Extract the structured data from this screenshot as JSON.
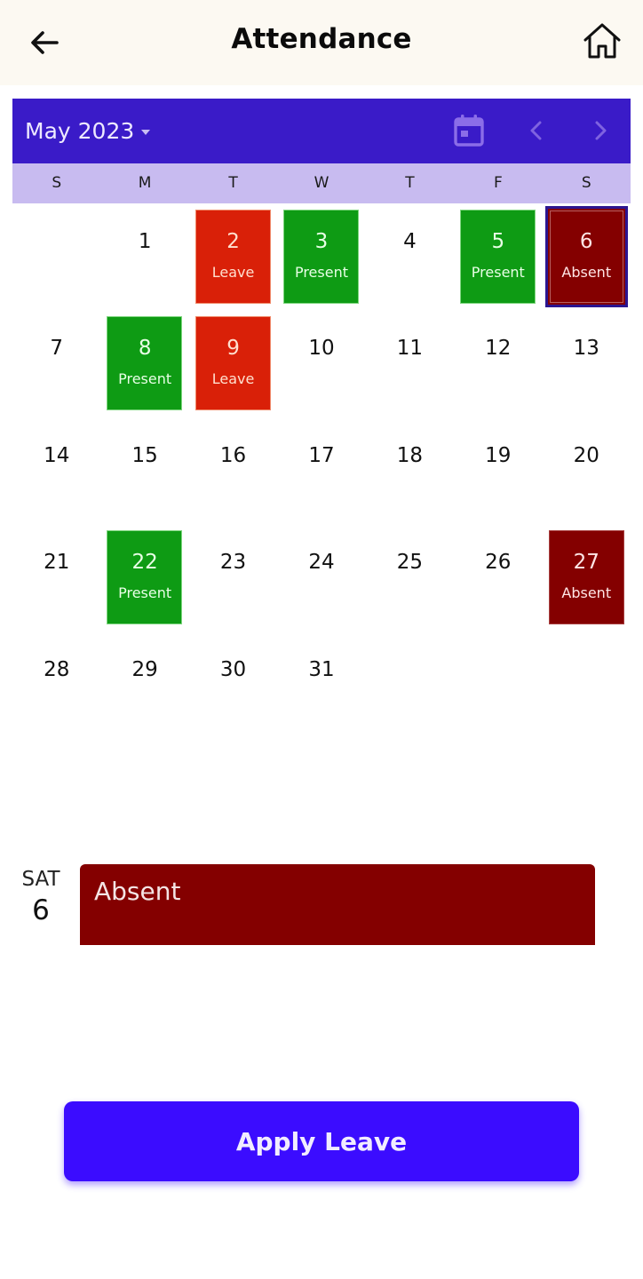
{
  "app_bar": {
    "title": "Attendance",
    "back_icon": "arrow-left-icon",
    "home_icon": "home-icon",
    "background": "#fcf9f2"
  },
  "calendar": {
    "month_label": "May 2023",
    "header_color": "#3a1bc8",
    "weekday_bar_color": "#c8bbf0",
    "icons": {
      "calendar": "calendar-icon",
      "prev": "chevron-left-icon",
      "next": "chevron-right-icon"
    },
    "weekdays": [
      "S",
      "M",
      "T",
      "W",
      "T",
      "F",
      "S"
    ],
    "days": [
      {
        "day": "",
        "status": ""
      },
      {
        "day": "1",
        "status": ""
      },
      {
        "day": "2",
        "status": "Leave"
      },
      {
        "day": "3",
        "status": "Present"
      },
      {
        "day": "4",
        "status": ""
      },
      {
        "day": "5",
        "status": "Present"
      },
      {
        "day": "6",
        "status": "Absent",
        "selected": true
      },
      {
        "day": "7",
        "status": ""
      },
      {
        "day": "8",
        "status": "Present"
      },
      {
        "day": "9",
        "status": "Leave"
      },
      {
        "day": "10",
        "status": ""
      },
      {
        "day": "11",
        "status": ""
      },
      {
        "day": "12",
        "status": ""
      },
      {
        "day": "13",
        "status": ""
      },
      {
        "day": "14",
        "status": ""
      },
      {
        "day": "15",
        "status": ""
      },
      {
        "day": "16",
        "status": ""
      },
      {
        "day": "17",
        "status": ""
      },
      {
        "day": "18",
        "status": ""
      },
      {
        "day": "19",
        "status": ""
      },
      {
        "day": "20",
        "status": ""
      },
      {
        "day": "21",
        "status": ""
      },
      {
        "day": "22",
        "status": "Present"
      },
      {
        "day": "23",
        "status": ""
      },
      {
        "day": "24",
        "status": ""
      },
      {
        "day": "25",
        "status": ""
      },
      {
        "day": "26",
        "status": ""
      },
      {
        "day": "27",
        "status": "Absent"
      },
      {
        "day": "28",
        "status": ""
      },
      {
        "day": "29",
        "status": ""
      },
      {
        "day": "30",
        "status": ""
      },
      {
        "day": "31",
        "status": ""
      }
    ],
    "status_colors": {
      "Present": "#0e9b14",
      "Leave": "#d92008",
      "Absent": "#840000"
    }
  },
  "selected_day": {
    "weekday": "SAT",
    "day": "6",
    "event_label": "Absent",
    "event_color": "#840000"
  },
  "apply_button": {
    "label": "Apply Leave",
    "color": "#3b0cff"
  }
}
